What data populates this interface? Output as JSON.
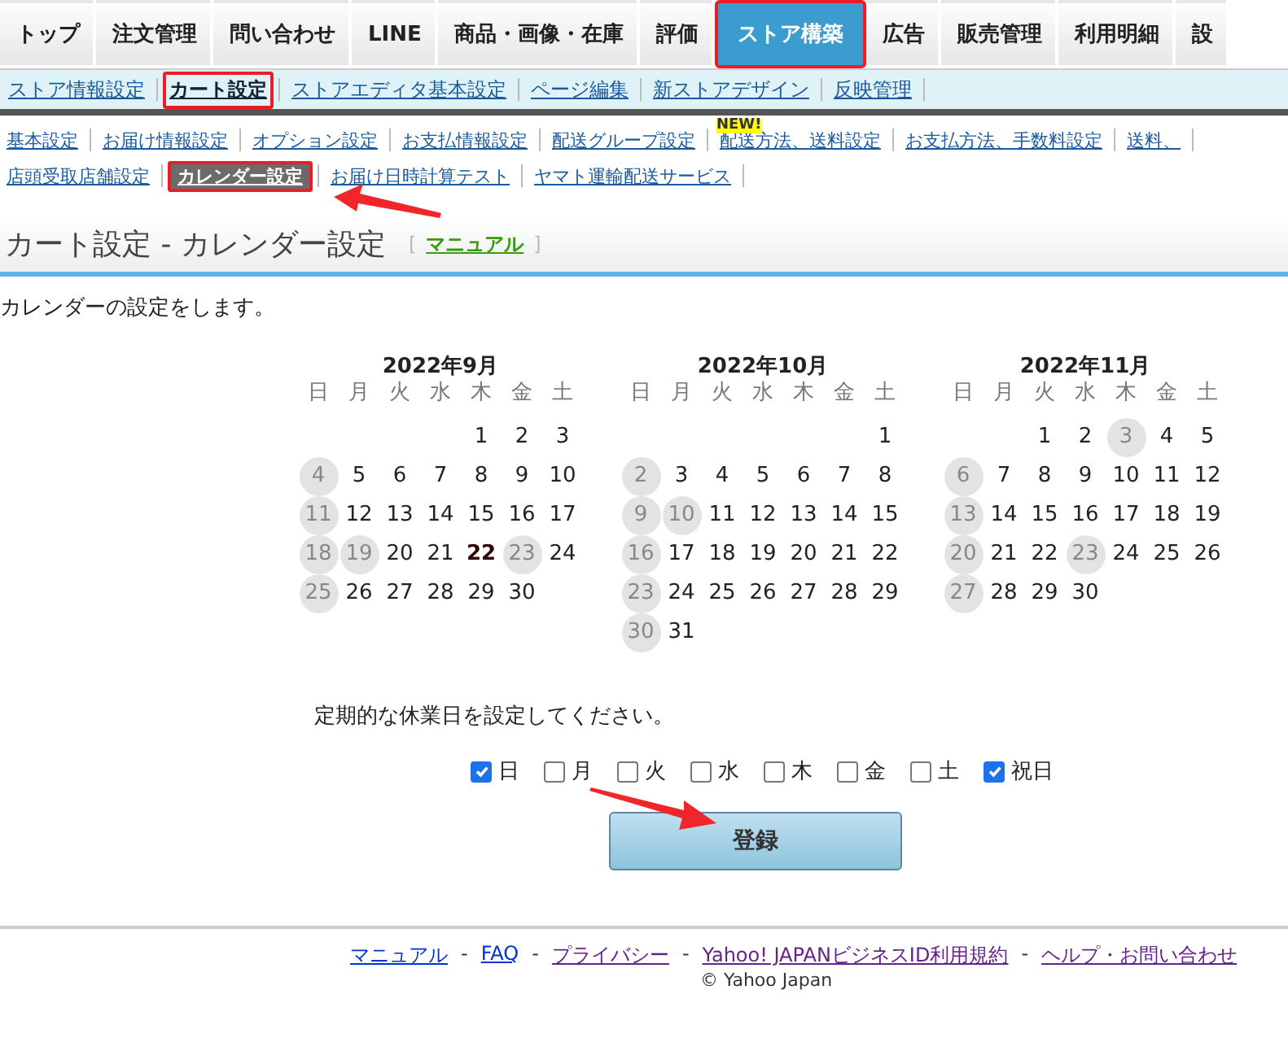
{
  "main_tabs": [
    {
      "label": "トップ",
      "selected": false,
      "highlighted": false
    },
    {
      "label": "注文管理",
      "selected": false,
      "highlighted": false
    },
    {
      "label": "問い合わせ",
      "selected": false,
      "highlighted": false
    },
    {
      "label": "LINE",
      "selected": false,
      "highlighted": false
    },
    {
      "label": "商品・画像・在庫",
      "selected": false,
      "highlighted": false
    },
    {
      "label": "評価",
      "selected": false,
      "highlighted": false
    },
    {
      "label": "ストア構築",
      "selected": true,
      "highlighted": true
    },
    {
      "label": "広告",
      "selected": false,
      "highlighted": false
    },
    {
      "label": "販売管理",
      "selected": false,
      "highlighted": false
    },
    {
      "label": "利用明細",
      "selected": false,
      "highlighted": false
    },
    {
      "label": "設",
      "selected": false,
      "highlighted": false
    }
  ],
  "sub_tabs": [
    {
      "label": "ストア情報設定",
      "selected": false,
      "highlighted": false
    },
    {
      "label": "カート設定",
      "selected": true,
      "highlighted": true
    },
    {
      "label": "ストアエディタ基本設定",
      "selected": false,
      "highlighted": false
    },
    {
      "label": "ページ編集",
      "selected": false,
      "highlighted": false
    },
    {
      "label": "新ストアデザイン",
      "selected": false,
      "highlighted": false
    },
    {
      "label": "反映管理",
      "selected": false,
      "highlighted": false
    }
  ],
  "cart_menu_rows": [
    [
      {
        "label": "基本設定",
        "selected": false,
        "highlighted": false
      },
      {
        "label": "お届け情報設定",
        "selected": false,
        "highlighted": false
      },
      {
        "label": "オプション設定",
        "selected": false,
        "highlighted": false
      },
      {
        "label": "お支払情報設定",
        "selected": false,
        "highlighted": false
      },
      {
        "label": "配送グループ設定",
        "selected": false,
        "highlighted": false
      },
      {
        "label": "配送方法、送料設定",
        "selected": false,
        "highlighted": false,
        "badge": "NEW!"
      },
      {
        "label": "お支払方法、手数料設定",
        "selected": false,
        "highlighted": false
      },
      {
        "label": "送料、",
        "selected": false,
        "highlighted": false
      }
    ],
    [
      {
        "label": "店頭受取店舗設定",
        "selected": false,
        "highlighted": false
      },
      {
        "label": "カレンダー設定",
        "selected": true,
        "highlighted": true
      },
      {
        "label": "お届け日時計算テスト",
        "selected": false,
        "highlighted": false
      },
      {
        "label": "ヤマト運輸配送サービス",
        "selected": false,
        "highlighted": false
      }
    ]
  ],
  "page_header": {
    "title": "カート設定 - カレンダー設定",
    "bracket_open": "[",
    "manual_link": "マニュアル",
    "bracket_close": "]"
  },
  "description": "カレンダーの設定をします。",
  "calendars": [
    {
      "title": "2022年9月",
      "weekdays": [
        "日",
        "月",
        "火",
        "水",
        "木",
        "金",
        "土"
      ],
      "weeks": [
        {
          "kind": "leading",
          "days": [
            {
              "day": "1",
              "closed": false,
              "today": false
            },
            {
              "day": "2",
              "closed": false,
              "today": false
            },
            {
              "day": "3",
              "closed": false,
              "today": false
            }
          ]
        },
        {
          "kind": "full",
          "days": [
            {
              "day": "4",
              "closed": true,
              "today": false
            },
            {
              "day": "5",
              "closed": false,
              "today": false
            },
            {
              "day": "6",
              "closed": false,
              "today": false
            },
            {
              "day": "7",
              "closed": false,
              "today": false
            },
            {
              "day": "8",
              "closed": false,
              "today": false
            },
            {
              "day": "9",
              "closed": false,
              "today": false
            },
            {
              "day": "10",
              "closed": false,
              "today": false
            }
          ]
        },
        {
          "kind": "full",
          "days": [
            {
              "day": "11",
              "closed": true,
              "today": false
            },
            {
              "day": "12",
              "closed": false,
              "today": false
            },
            {
              "day": "13",
              "closed": false,
              "today": false
            },
            {
              "day": "14",
              "closed": false,
              "today": false
            },
            {
              "day": "15",
              "closed": false,
              "today": false
            },
            {
              "day": "16",
              "closed": false,
              "today": false
            },
            {
              "day": "17",
              "closed": false,
              "today": false
            }
          ]
        },
        {
          "kind": "full",
          "days": [
            {
              "day": "18",
              "closed": true,
              "today": false
            },
            {
              "day": "19",
              "closed": true,
              "today": false
            },
            {
              "day": "20",
              "closed": false,
              "today": false
            },
            {
              "day": "21",
              "closed": false,
              "today": false
            },
            {
              "day": "22",
              "closed": false,
              "today": true
            },
            {
              "day": "23",
              "closed": true,
              "today": false
            },
            {
              "day": "24",
              "closed": false,
              "today": false
            }
          ]
        },
        {
          "kind": "trailing",
          "days": [
            {
              "day": "25",
              "closed": true,
              "today": false
            },
            {
              "day": "26",
              "closed": false,
              "today": false
            },
            {
              "day": "27",
              "closed": false,
              "today": false
            },
            {
              "day": "28",
              "closed": false,
              "today": false
            },
            {
              "day": "29",
              "closed": false,
              "today": false
            },
            {
              "day": "30",
              "closed": false,
              "today": false
            }
          ]
        }
      ]
    },
    {
      "title": "2022年10月",
      "weekdays": [
        "日",
        "月",
        "火",
        "水",
        "木",
        "金",
        "土"
      ],
      "weeks": [
        {
          "kind": "leading",
          "days": [
            {
              "day": "1",
              "closed": false,
              "today": false
            }
          ]
        },
        {
          "kind": "full",
          "days": [
            {
              "day": "2",
              "closed": true,
              "today": false
            },
            {
              "day": "3",
              "closed": false,
              "today": false
            },
            {
              "day": "4",
              "closed": false,
              "today": false
            },
            {
              "day": "5",
              "closed": false,
              "today": false
            },
            {
              "day": "6",
              "closed": false,
              "today": false
            },
            {
              "day": "7",
              "closed": false,
              "today": false
            },
            {
              "day": "8",
              "closed": false,
              "today": false
            }
          ]
        },
        {
          "kind": "full",
          "days": [
            {
              "day": "9",
              "closed": true,
              "today": false
            },
            {
              "day": "10",
              "closed": true,
              "today": false
            },
            {
              "day": "11",
              "closed": false,
              "today": false
            },
            {
              "day": "12",
              "closed": false,
              "today": false
            },
            {
              "day": "13",
              "closed": false,
              "today": false
            },
            {
              "day": "14",
              "closed": false,
              "today": false
            },
            {
              "day": "15",
              "closed": false,
              "today": false
            }
          ]
        },
        {
          "kind": "full",
          "days": [
            {
              "day": "16",
              "closed": true,
              "today": false
            },
            {
              "day": "17",
              "closed": false,
              "today": false
            },
            {
              "day": "18",
              "closed": false,
              "today": false
            },
            {
              "day": "19",
              "closed": false,
              "today": false
            },
            {
              "day": "20",
              "closed": false,
              "today": false
            },
            {
              "day": "21",
              "closed": false,
              "today": false
            },
            {
              "day": "22",
              "closed": false,
              "today": false
            }
          ]
        },
        {
          "kind": "full",
          "days": [
            {
              "day": "23",
              "closed": true,
              "today": false
            },
            {
              "day": "24",
              "closed": false,
              "today": false
            },
            {
              "day": "25",
              "closed": false,
              "today": false
            },
            {
              "day": "26",
              "closed": false,
              "today": false
            },
            {
              "day": "27",
              "closed": false,
              "today": false
            },
            {
              "day": "28",
              "closed": false,
              "today": false
            },
            {
              "day": "29",
              "closed": false,
              "today": false
            }
          ]
        },
        {
          "kind": "trailing",
          "days": [
            {
              "day": "30",
              "closed": true,
              "today": false
            },
            {
              "day": "31",
              "closed": false,
              "today": false
            }
          ]
        }
      ]
    },
    {
      "title": "2022年11月",
      "weekdays": [
        "日",
        "月",
        "火",
        "水",
        "木",
        "金",
        "土"
      ],
      "weeks": [
        {
          "kind": "leading",
          "days": [
            {
              "day": "1",
              "closed": false,
              "today": false
            },
            {
              "day": "2",
              "closed": false,
              "today": false
            },
            {
              "day": "3",
              "closed": true,
              "today": false
            },
            {
              "day": "4",
              "closed": false,
              "today": false
            },
            {
              "day": "5",
              "closed": false,
              "today": false
            }
          ]
        },
        {
          "kind": "full",
          "days": [
            {
              "day": "6",
              "closed": true,
              "today": false
            },
            {
              "day": "7",
              "closed": false,
              "today": false
            },
            {
              "day": "8",
              "closed": false,
              "today": false
            },
            {
              "day": "9",
              "closed": false,
              "today": false
            },
            {
              "day": "10",
              "closed": false,
              "today": false
            },
            {
              "day": "11",
              "closed": false,
              "today": false
            },
            {
              "day": "12",
              "closed": false,
              "today": false
            }
          ]
        },
        {
          "kind": "full",
          "days": [
            {
              "day": "13",
              "closed": true,
              "today": false
            },
            {
              "day": "14",
              "closed": false,
              "today": false
            },
            {
              "day": "15",
              "closed": false,
              "today": false
            },
            {
              "day": "16",
              "closed": false,
              "today": false
            },
            {
              "day": "17",
              "closed": false,
              "today": false
            },
            {
              "day": "18",
              "closed": false,
              "today": false
            },
            {
              "day": "19",
              "closed": false,
              "today": false
            }
          ]
        },
        {
          "kind": "full",
          "days": [
            {
              "day": "20",
              "closed": true,
              "today": false
            },
            {
              "day": "21",
              "closed": false,
              "today": false
            },
            {
              "day": "22",
              "closed": false,
              "today": false
            },
            {
              "day": "23",
              "closed": true,
              "today": false
            },
            {
              "day": "24",
              "closed": false,
              "today": false
            },
            {
              "day": "25",
              "closed": false,
              "today": false
            },
            {
              "day": "26",
              "closed": false,
              "today": false
            }
          ]
        },
        {
          "kind": "trailing",
          "days": [
            {
              "day": "27",
              "closed": true,
              "today": false
            },
            {
              "day": "28",
              "closed": false,
              "today": false
            },
            {
              "day": "29",
              "closed": false,
              "today": false
            },
            {
              "day": "30",
              "closed": false,
              "today": false
            }
          ]
        }
      ]
    }
  ],
  "holidays_prompt": "定期的な休業日を設定してください。",
  "holiday_options": [
    {
      "label": "日",
      "checked": true
    },
    {
      "label": "月",
      "checked": false
    },
    {
      "label": "火",
      "checked": false
    },
    {
      "label": "水",
      "checked": false
    },
    {
      "label": "木",
      "checked": false
    },
    {
      "label": "金",
      "checked": false
    },
    {
      "label": "土",
      "checked": false
    },
    {
      "label": "祝日",
      "checked": true
    }
  ],
  "submit_button": "登録",
  "footer": {
    "links": [
      {
        "label": "マニュアル",
        "visited": false
      },
      {
        "label": "FAQ",
        "visited": false
      },
      {
        "label": "プライバシー",
        "visited": true
      },
      {
        "label": "Yahoo! JAPANビジネスID利用規約",
        "visited": true
      },
      {
        "label": "ヘルプ・お問い合わせ",
        "visited": true
      }
    ],
    "separator": "-",
    "copyright": "© Yahoo Japan"
  }
}
